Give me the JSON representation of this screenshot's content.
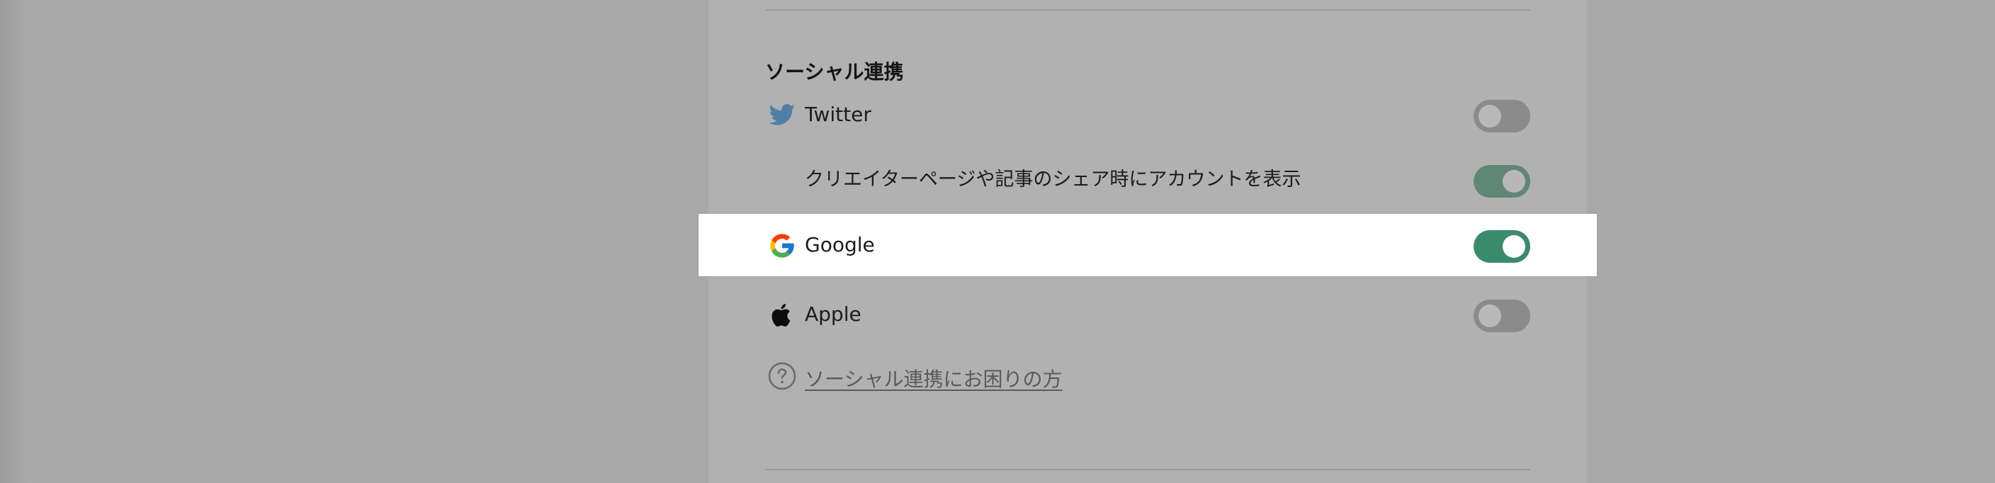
{
  "social": {
    "title": "ソーシャル連携",
    "twitter": {
      "label": "Twitter",
      "icon": "twitter-bird-icon",
      "enabled": false,
      "share_option": {
        "label": "クリエイターページや記事のシェア時にアカウントを表示",
        "enabled": true
      }
    },
    "google": {
      "label": "Google",
      "icon": "google-g-icon",
      "enabled": true
    },
    "apple": {
      "label": "Apple",
      "icon": "apple-icon",
      "enabled": false
    },
    "help": {
      "label": "ソーシャル連携にお困りの方",
      "icon": "help-circle-icon"
    }
  },
  "colors": {
    "toggle_on_highlight": "#3a8a6c",
    "toggle_on_dimmed": "#5f8775",
    "toggle_off": "#8b8b8b",
    "twitter_blue_dimmed": "#4f7fa6"
  }
}
